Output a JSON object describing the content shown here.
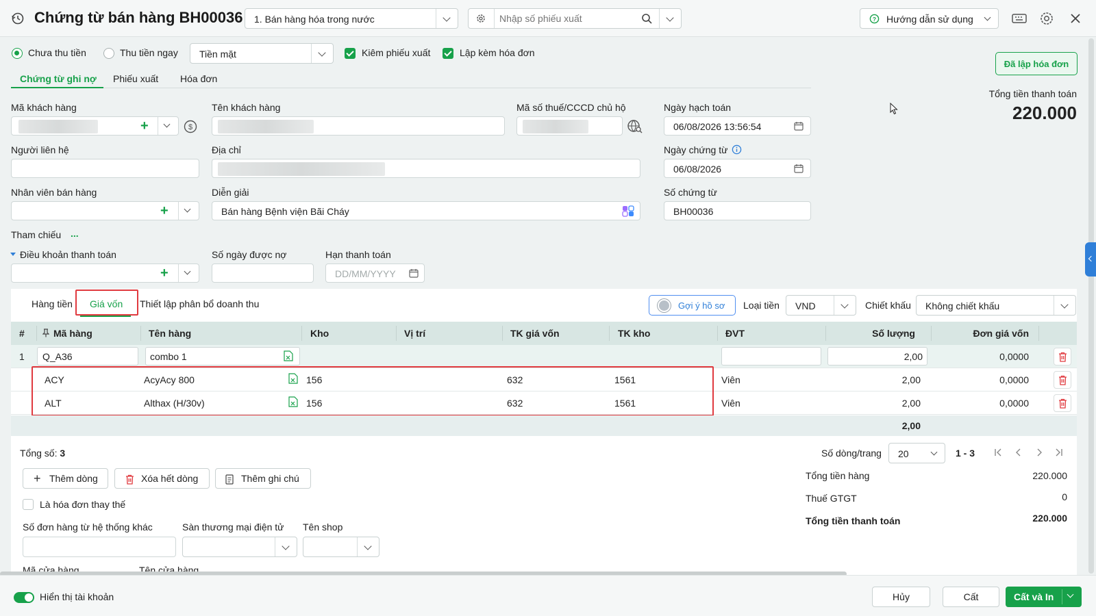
{
  "header": {
    "title": "Chứng từ bán hàng BH00036",
    "type_select": "1. Bán hàng hóa trong nước",
    "search_placeholder": "Nhập số phiếu xuất",
    "help_label": "Hướng dẫn sử dụng"
  },
  "payment": {
    "option_unpaid": "Chưa thu tiền",
    "option_paid": "Thu tiền ngay",
    "method": "Tiền mặt",
    "check_export": "Kiêm phiếu xuất",
    "check_invoice": "Lập kèm hóa đơn"
  },
  "tabs": [
    "Chứng từ ghi nợ",
    "Phiếu xuất",
    "Hóa đơn"
  ],
  "invoice_button": "Đã lập hóa đơn",
  "total_box": {
    "label": "Tổng tiền thanh toán",
    "value": "220.000"
  },
  "form": {
    "customer_code_label": "Mã khách hàng",
    "customer_name_label": "Tên khách hàng",
    "tax_code_label": "Mã số thuế/CCCD chủ hộ",
    "posting_date_label": "Ngày hạch toán",
    "posting_date": "06/08/2026 13:56:54",
    "contact_label": "Người liên hệ",
    "address_label": "Địa chỉ",
    "doc_date_label": "Ngày chứng từ",
    "doc_date": "06/08/2026",
    "sales_staff_label": "Nhân viên bán hàng",
    "description_label": "Diễn giải",
    "description": "Bán hàng Bệnh viện Bãi Cháy",
    "doc_no_label": "Số chứng từ",
    "doc_no": "BH00036",
    "reference_label": "Tham chiếu",
    "reference_more": "...",
    "payment_terms_label": "Điều khoản thanh toán",
    "credit_days_label": "Số ngày được nợ",
    "due_date_label": "Hạn thanh toán",
    "due_date_placeholder": "DD/MM/YYYY"
  },
  "grid_tabs": [
    "Hàng tiền",
    "Giá vốn",
    "Thiết lập phân bổ doanh thu"
  ],
  "grid_tools": {
    "suggest": "Gợi ý hồ sơ",
    "currency_label": "Loại tiền",
    "currency": "VND",
    "discount_label": "Chiết khấu",
    "discount": "Không chiết khấu"
  },
  "columns": [
    "#",
    "Mã hàng",
    "Tên hàng",
    "Kho",
    "Vị trí",
    "TK giá vốn",
    "TK kho",
    "ĐVT",
    "Số lượng",
    "Đơn giá vốn"
  ],
  "rows": [
    {
      "no": "1",
      "code": "Q_A36",
      "name": "combo 1",
      "warehouse": "",
      "location": "",
      "cost_acc": "",
      "stock_acc": "",
      "unit": "",
      "qty": "2,00",
      "price": "0,0000"
    },
    {
      "no": "",
      "code": "ACY",
      "name": "AcyAcy 800",
      "warehouse": "156",
      "location": "",
      "cost_acc": "632",
      "stock_acc": "1561",
      "unit": "Viên",
      "qty": "2,00",
      "price": "0,0000"
    },
    {
      "no": "",
      "code": "ALT",
      "name": "Althax (H/30v)",
      "warehouse": "156",
      "location": "",
      "cost_acc": "632",
      "stock_acc": "1561",
      "unit": "Viên",
      "qty": "2,00",
      "price": "0,0000"
    }
  ],
  "grid_total_qty": "2,00",
  "summary": {
    "count_label": "Tổng số:",
    "count": "3",
    "rows_per_page_label": "Số dòng/trang",
    "rows_per_page": "20",
    "range": "1 - 3",
    "goods_total_label": "Tổng tiền hàng",
    "goods_total": "220.000",
    "vat_label": "Thuế GTGT",
    "vat": "0",
    "pay_total_label": "Tổng tiền thanh toán",
    "pay_total": "220.000"
  },
  "actions": {
    "add_row": "Thêm dòng",
    "delete_rows": "Xóa hết dòng",
    "add_note": "Thêm ghi chú",
    "replace_invoice": "Là hóa đơn thay thế",
    "ext_order_label": "Số đơn hàng từ hệ thống khác",
    "marketplace_label": "Sàn thương mại điện tử",
    "shop_label": "Tên shop",
    "store_code_label": "Mã cửa hàng",
    "store_name_label": "Tên cửa hàng"
  },
  "footer": {
    "show_accounts": "Hiển thị tài khoản",
    "cancel": "Hủy",
    "save": "Cất",
    "save_print": "Cất và In"
  },
  "colors": {
    "accent": "#17a14a",
    "highlight": "#e0393e",
    "header_row": "#d8e6e3"
  }
}
